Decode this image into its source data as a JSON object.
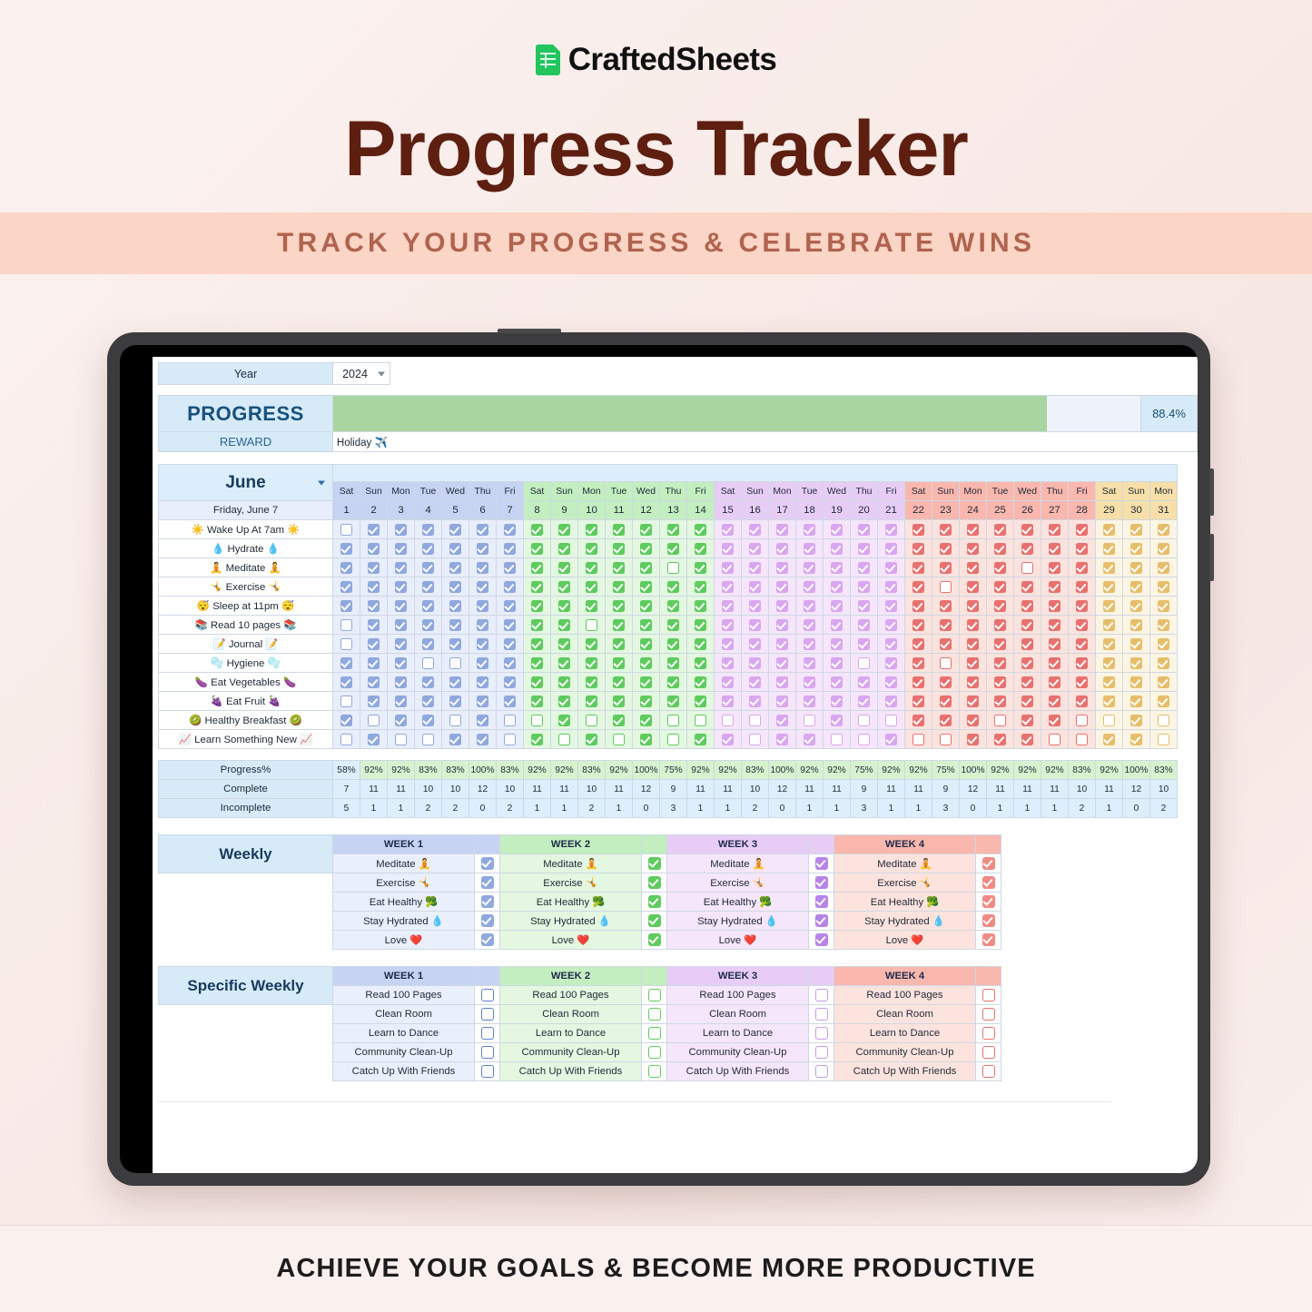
{
  "brand": {
    "name": "CraftedSheets",
    "icon": "sheets-logo-icon"
  },
  "header": {
    "title": "Progress Tracker",
    "subtitle": "TRACK YOUR PROGRESS & CELEBRATE WINS"
  },
  "footer": {
    "tagline": "ACHIEVE YOUR GOALS & BECOME MORE PRODUCTIVE"
  },
  "sheet": {
    "year_label": "Year",
    "year_value": "2024",
    "progress_label": "PROGRESS",
    "progress_pct": "88.4%",
    "progress_fill_percent": 88.4,
    "reward_label": "REWARD",
    "reward_value": "Holiday ✈️",
    "month": "June",
    "today": "Friday, June 7",
    "weekdays": [
      "Sat",
      "Sun",
      "Mon",
      "Tue",
      "Wed",
      "Thu",
      "Fri",
      "Sat",
      "Sun",
      "Mon",
      "Tue",
      "Wed",
      "Thu",
      "Fri",
      "Sat",
      "Sun",
      "Mon",
      "Tue",
      "Wed",
      "Thu",
      "Fri",
      "Sat",
      "Sun",
      "Mon",
      "Tue",
      "Wed",
      "Thu",
      "Fri",
      "Sat",
      "Sun",
      "Mon"
    ],
    "days": [
      "1",
      "2",
      "3",
      "4",
      "5",
      "6",
      "7",
      "8",
      "9",
      "10",
      "11",
      "12",
      "13",
      "14",
      "15",
      "16",
      "17",
      "18",
      "19",
      "20",
      "21",
      "22",
      "23",
      "24",
      "25",
      "26",
      "27",
      "28",
      "29",
      "30",
      "31"
    ],
    "habits": [
      "☀️ Wake Up At 7am ☀️",
      "💧 Hydrate 💧",
      "🧘 Meditate 🧘",
      "🤸 Exercise 🤸",
      "😴 Sleep at 11pm 😴",
      "📚 Read 10 pages 📚",
      "📝 Journal 📝",
      "🫧 Hygiene 🫧",
      "🍆 Eat Vegetables 🍆",
      "🍇 Eat Fruit 🍇",
      "🥝 Healthy Breakfast 🥝",
      "📈 Learn Something New 📈"
    ],
    "checks": [
      [
        0,
        1,
        1,
        1,
        1,
        1,
        1,
        1,
        1,
        1,
        1,
        1,
        1,
        1,
        1,
        1,
        1,
        1,
        1,
        1,
        1,
        1,
        1,
        1,
        1,
        1,
        1,
        1,
        1,
        1,
        1
      ],
      [
        1,
        1,
        1,
        1,
        1,
        1,
        1,
        1,
        1,
        1,
        1,
        1,
        1,
        1,
        1,
        1,
        1,
        1,
        1,
        1,
        1,
        1,
        1,
        1,
        1,
        1,
        1,
        1,
        1,
        1,
        1
      ],
      [
        1,
        1,
        1,
        1,
        1,
        1,
        1,
        1,
        1,
        1,
        1,
        1,
        0,
        1,
        1,
        1,
        1,
        1,
        1,
        1,
        1,
        1,
        1,
        1,
        1,
        0,
        1,
        1,
        1,
        1,
        1
      ],
      [
        1,
        1,
        1,
        1,
        1,
        1,
        1,
        1,
        1,
        1,
        1,
        1,
        1,
        1,
        1,
        1,
        1,
        1,
        1,
        1,
        1,
        1,
        0,
        1,
        1,
        1,
        1,
        1,
        1,
        1,
        1
      ],
      [
        1,
        1,
        1,
        1,
        1,
        1,
        1,
        1,
        1,
        1,
        1,
        1,
        1,
        1,
        1,
        1,
        1,
        1,
        1,
        1,
        1,
        1,
        1,
        1,
        1,
        1,
        1,
        1,
        1,
        1,
        1
      ],
      [
        0,
        1,
        1,
        1,
        1,
        1,
        1,
        1,
        1,
        0,
        1,
        1,
        1,
        1,
        1,
        1,
        1,
        1,
        1,
        1,
        1,
        1,
        1,
        1,
        1,
        1,
        1,
        1,
        1,
        1,
        1
      ],
      [
        0,
        1,
        1,
        1,
        1,
        1,
        1,
        1,
        1,
        1,
        1,
        1,
        1,
        1,
        1,
        1,
        1,
        1,
        1,
        1,
        1,
        1,
        1,
        1,
        1,
        1,
        1,
        1,
        1,
        1,
        1
      ],
      [
        1,
        1,
        1,
        0,
        0,
        1,
        1,
        1,
        1,
        1,
        1,
        1,
        1,
        1,
        1,
        1,
        1,
        1,
        1,
        0,
        1,
        1,
        0,
        1,
        1,
        1,
        1,
        1,
        1,
        1,
        1
      ],
      [
        1,
        1,
        1,
        1,
        1,
        1,
        1,
        1,
        1,
        1,
        1,
        1,
        1,
        1,
        1,
        1,
        1,
        1,
        1,
        1,
        1,
        1,
        1,
        1,
        1,
        1,
        1,
        1,
        1,
        1,
        1
      ],
      [
        0,
        1,
        1,
        1,
        1,
        1,
        1,
        1,
        1,
        1,
        1,
        1,
        1,
        1,
        1,
        1,
        1,
        1,
        1,
        1,
        1,
        1,
        1,
        1,
        1,
        1,
        1,
        1,
        1,
        1,
        1
      ],
      [
        1,
        0,
        1,
        1,
        0,
        1,
        0,
        0,
        1,
        0,
        1,
        1,
        0,
        0,
        0,
        0,
        1,
        0,
        1,
        0,
        0,
        1,
        1,
        1,
        0,
        1,
        1,
        0,
        0,
        1,
        0
      ],
      [
        0,
        1,
        0,
        0,
        1,
        1,
        0,
        1,
        0,
        1,
        0,
        1,
        0,
        1,
        1,
        0,
        1,
        1,
        0,
        0,
        1,
        0,
        0,
        1,
        1,
        1,
        0,
        0,
        1,
        1,
        0
      ]
    ],
    "stats": {
      "progress_label": "Progress%",
      "complete_label": "Complete",
      "incomplete_label": "Incomplete",
      "progress": [
        "58%",
        "92%",
        "92%",
        "83%",
        "83%",
        "100%",
        "83%",
        "92%",
        "92%",
        "83%",
        "92%",
        "100%",
        "75%",
        "92%",
        "92%",
        "83%",
        "100%",
        "92%",
        "92%",
        "75%",
        "92%",
        "92%",
        "75%",
        "100%",
        "92%",
        "92%",
        "92%",
        "83%",
        "92%",
        "100%",
        "83%"
      ],
      "complete": [
        "7",
        "11",
        "11",
        "10",
        "10",
        "12",
        "10",
        "11",
        "11",
        "10",
        "11",
        "12",
        "9",
        "11",
        "11",
        "10",
        "12",
        "11",
        "11",
        "9",
        "11",
        "11",
        "9",
        "12",
        "11",
        "11",
        "11",
        "10",
        "11",
        "12",
        "10"
      ],
      "incomplete": [
        "5",
        "1",
        "1",
        "2",
        "2",
        "0",
        "2",
        "1",
        "1",
        "2",
        "1",
        "0",
        "3",
        "1",
        "1",
        "2",
        "0",
        "1",
        "1",
        "3",
        "1",
        "1",
        "3",
        "0",
        "1",
        "1",
        "1",
        "2",
        "1",
        "0",
        "2"
      ]
    },
    "weekly": {
      "side_label": "Weekly",
      "week_headers": [
        "WEEK 1",
        "WEEK 2",
        "WEEK 3",
        "WEEK 4"
      ],
      "tasks": [
        "Meditate 🧘",
        "Exercise 🤸",
        "Eat Healthy 🥦",
        "Stay Hydrated 💧",
        "Love ❤️"
      ],
      "checked": [
        [
          1,
          1,
          1,
          1,
          1
        ],
        [
          1,
          1,
          1,
          1,
          1
        ],
        [
          1,
          1,
          1,
          1,
          1
        ],
        [
          1,
          1,
          1,
          1,
          1
        ]
      ]
    },
    "specific_weekly": {
      "side_label": "Specific Weekly",
      "week_headers": [
        "WEEK 1",
        "WEEK 2",
        "WEEK 3",
        "WEEK 4"
      ],
      "tasks": [
        "Read 100 Pages",
        "Clean Room",
        "Learn to Dance",
        "Community Clean-Up",
        "Catch Up With Friends"
      ],
      "checked": [
        [
          0,
          0,
          0,
          0,
          0
        ],
        [
          0,
          0,
          0,
          0,
          0
        ],
        [
          0,
          0,
          0,
          0,
          0
        ],
        [
          0,
          0,
          0,
          0,
          0
        ]
      ]
    }
  },
  "colors": {
    "brand_green": "#22c55e",
    "title_brown": "#5e1f11",
    "banner_peach": "#fbd5c5",
    "subtitle_text": "#b0634f",
    "header_blue": "#d6eaf8",
    "progress_fill": "#a9d5a0",
    "week1": "#8fa8de",
    "week2": "#5ecb5e",
    "week3": "#d9a6ef",
    "week4": "#e8716f",
    "week5": "#e6be6b"
  }
}
